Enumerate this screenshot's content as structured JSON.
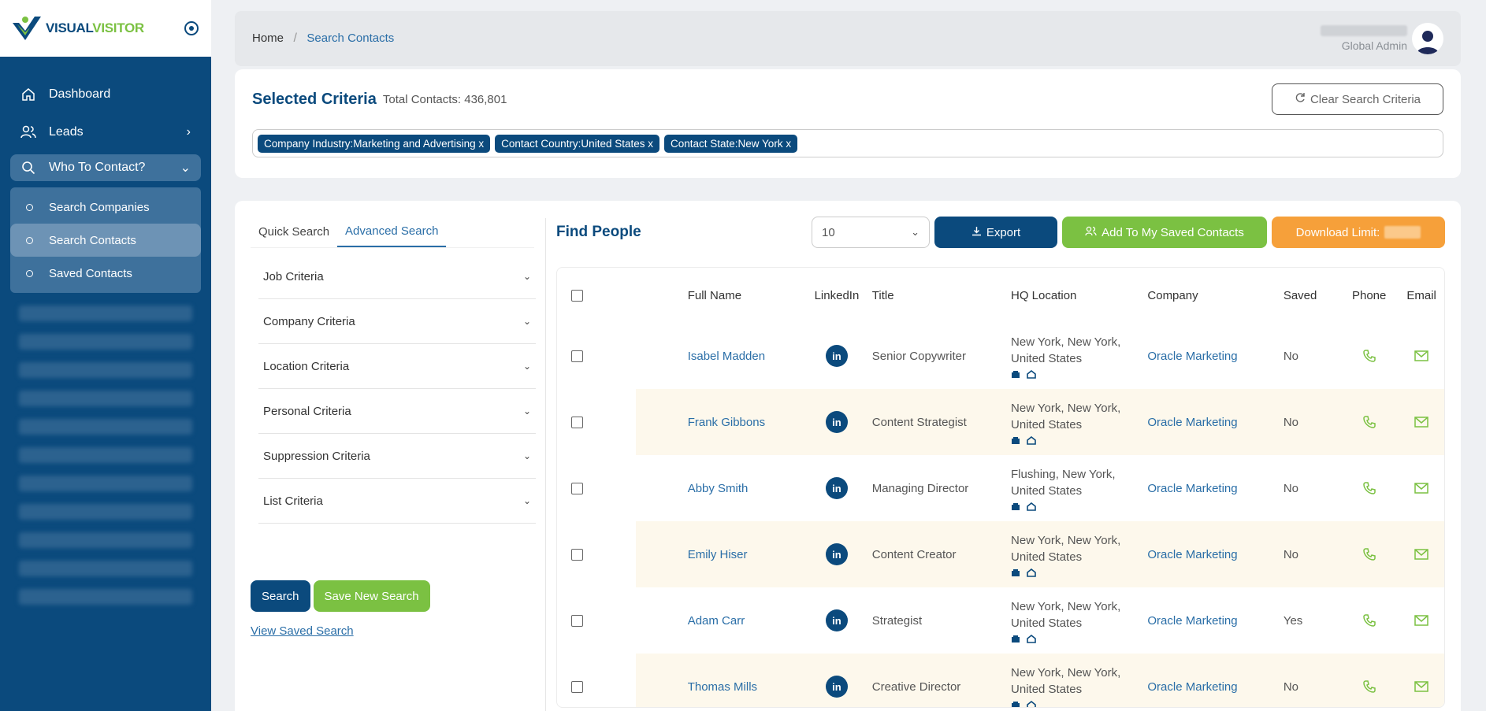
{
  "sidebar": {
    "logo": {
      "part1": "VISUAL",
      "part2": "VISITOR"
    },
    "nav": [
      {
        "label": "Dashboard"
      },
      {
        "label": "Leads"
      },
      {
        "label": "Who To Contact?"
      }
    ],
    "sub": [
      {
        "label": "Search Companies"
      },
      {
        "label": "Search Contacts"
      },
      {
        "label": "Saved Contacts"
      }
    ]
  },
  "header": {
    "breadcrumb_home": "Home",
    "breadcrumb_sep": "/",
    "breadcrumb_current": "Search Contacts",
    "user_role": "Global Admin"
  },
  "criteria": {
    "title": "Selected Criteria",
    "total": "Total Contacts: 436,801",
    "clear_label": "Clear Search Criteria",
    "chips": [
      "Company Industry:Marketing and Advertising x",
      "Contact Country:United States x",
      "Contact State:New York x"
    ]
  },
  "search_panel": {
    "tabs": [
      "Quick Search",
      "Advanced Search"
    ],
    "accordions": [
      "Job Criteria",
      "Company Criteria",
      "Location Criteria",
      "Personal Criteria",
      "Suppression Criteria",
      "List Criteria"
    ],
    "search_label": "Search",
    "save_label": "Save New Search",
    "view_saved_label": "View Saved Search"
  },
  "results": {
    "title": "Find People",
    "page_size": "10",
    "export_label": "Export",
    "add_label": "Add To My Saved Contacts",
    "download_label": "Download Limit:",
    "columns": [
      "Full Name",
      "LinkedIn",
      "Title",
      "HQ Location",
      "Company",
      "Saved",
      "Phone",
      "Email"
    ],
    "rows": [
      {
        "name": "Isabel Madden",
        "title": "Senior Copywriter",
        "loc1": "New York, New York,",
        "loc2": "United States",
        "company": "Oracle Marketing",
        "saved": "No"
      },
      {
        "name": "Frank Gibbons",
        "title": "Content Strategist",
        "loc1": "New York, New York,",
        "loc2": "United States",
        "company": "Oracle Marketing",
        "saved": "No"
      },
      {
        "name": "Abby Smith",
        "title": "Managing Director",
        "loc1": "Flushing, New York,",
        "loc2": "United States",
        "company": "Oracle Marketing",
        "saved": "No"
      },
      {
        "name": "Emily Hiser",
        "title": "Content Creator",
        "loc1": "New York, New York,",
        "loc2": "United States",
        "company": "Oracle Marketing",
        "saved": "No"
      },
      {
        "name": "Adam Carr",
        "title": "Strategist",
        "loc1": "New York, New York,",
        "loc2": "United States",
        "company": "Oracle Marketing",
        "saved": "Yes"
      },
      {
        "name": "Thomas Mills",
        "title": "Creative Director",
        "loc1": "New York, New York,",
        "loc2": "United States",
        "company": "Oracle Marketing",
        "saved": "No"
      }
    ]
  },
  "colors": {
    "brand_blue": "#0b4a7d",
    "brand_green": "#7bc142",
    "orange": "#f6a03a",
    "link": "#2a6ea7"
  }
}
